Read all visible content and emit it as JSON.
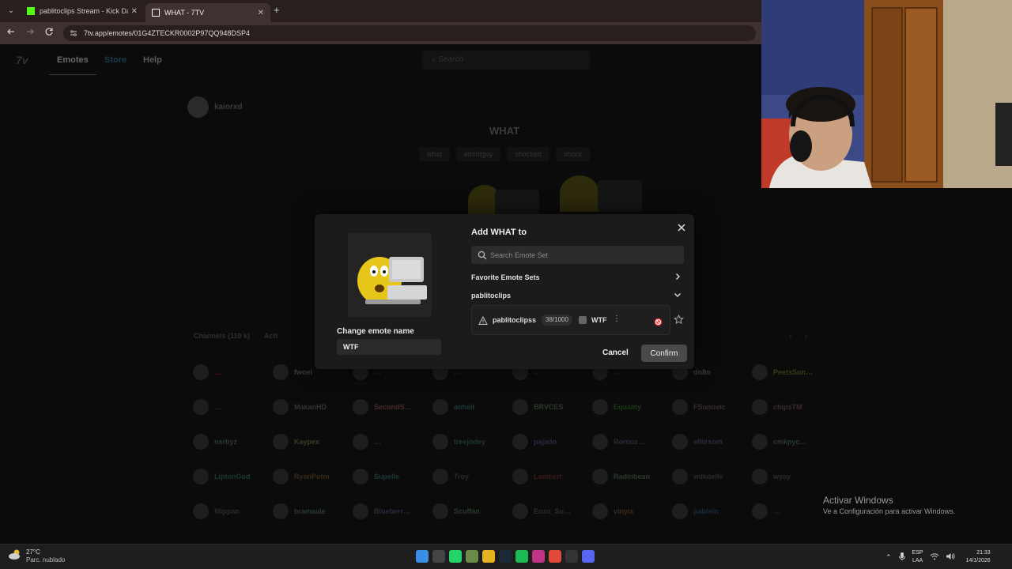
{
  "browser": {
    "tabs": [
      {
        "title": "pablitoclips Stream - Kick Dashb",
        "favicon_color": "#53fc18"
      },
      {
        "title": "WHAT - 7TV",
        "favicon_color": "#ffffff"
      }
    ],
    "new_tab_glyph": "+",
    "tab_menu_glyph": "⌄",
    "close_glyph": "✕",
    "url": "7tv.app/emotes/01G4ZTECKR0002P97QQ948DSP4"
  },
  "site": {
    "logo": "7v",
    "nav": {
      "emotes": "Emotes",
      "store": "Store",
      "help": "Help"
    },
    "search_placeholder": "Search"
  },
  "emote_page": {
    "uploader": "kaiorxd",
    "title": "WHAT",
    "tags": [
      "what",
      "emotiguy",
      "shocked",
      "shock"
    ],
    "channel_tabs": [
      "Channels (110 k)",
      "Acti"
    ]
  },
  "users": [
    {
      "name": "…",
      "color": "#5a1a1a"
    },
    {
      "name": "fwoel",
      "color": "#3a3a3a"
    },
    {
      "name": "…",
      "color": "#2a2a2a"
    },
    {
      "name": "…",
      "color": "#2a2a2a"
    },
    {
      "name": "…",
      "color": "#2a2a2a"
    },
    {
      "name": "…",
      "color": "#2a2a2a"
    },
    {
      "name": "dn8n",
      "color": "#3a3a3a"
    },
    {
      "name": "PeetsSun…",
      "color": "#3a3a18"
    },
    {
      "name": "…",
      "color": "#4a1a3a"
    },
    {
      "name": "MakanHD",
      "color": "#333333"
    },
    {
      "name": "SecondS…",
      "color": "#4a2a2a"
    },
    {
      "name": "aoheil",
      "color": "#1a3a3a"
    },
    {
      "name": "BRVCES",
      "color": "#2a3a2a"
    },
    {
      "name": "Equality",
      "color": "#1a3a1a"
    },
    {
      "name": "FSunovic",
      "color": "#3a2a2a"
    },
    {
      "name": "chipsTM",
      "color": "#3a2a2a"
    },
    {
      "name": "nsrbyz",
      "color": "#2a3a2a"
    },
    {
      "name": "Kaypex",
      "color": "#3a3a2a"
    },
    {
      "name": "…",
      "color": "#3a2a2a"
    },
    {
      "name": "treejodey",
      "color": "#1a3a2a"
    },
    {
      "name": "pajado",
      "color": "#2a2a3a"
    },
    {
      "name": "Rorouz…",
      "color": "#2a2a3a"
    },
    {
      "name": "elliirsom",
      "color": "#2a2a3a"
    },
    {
      "name": "cmkpyc…",
      "color": "#2a3a2a"
    },
    {
      "name": "LiptonGod",
      "color": "#1a3a2a"
    },
    {
      "name": "RyanPotm",
      "color": "#3a2a1a"
    },
    {
      "name": "Supelle",
      "color": "#1a3a3a"
    },
    {
      "name": "Troy",
      "color": "#2a2a2a"
    },
    {
      "name": "Lambert",
      "color": "#3a1a1a"
    },
    {
      "name": "Radiobean",
      "color": "#2a3a2a"
    },
    {
      "name": "wilkdelle",
      "color": "#2a2a2a"
    },
    {
      "name": "wyay",
      "color": "#2a2a2a"
    },
    {
      "name": "filippan",
      "color": "#2a2a2a"
    },
    {
      "name": "bramaale",
      "color": "#2a3a2a"
    },
    {
      "name": "Blueberr…",
      "color": "#2a2a3a"
    },
    {
      "name": "Scuffan",
      "color": "#2a3a2a"
    },
    {
      "name": "Enzo_Su…",
      "color": "#2a2a2a"
    },
    {
      "name": "vinyix",
      "color": "#3a2a1a"
    },
    {
      "name": "pablein",
      "color": "#1a2a3a"
    },
    {
      "name": "…",
      "color": "#1a2a3a"
    }
  ],
  "modal": {
    "title": "Add WHAT to",
    "search_placeholder": "Search Emote Set",
    "favorite_sets": "Favorite Emote Sets",
    "owner": "pablitoclips",
    "set": {
      "name": "pablitoclipss",
      "capacity": "38/1000",
      "alias": "WTF"
    },
    "rename_label": "Change emote name",
    "rename_value": "WTF",
    "cancel": "Cancel",
    "confirm": "Confirm"
  },
  "watermark": {
    "title": "Activar Windows",
    "subtitle": "Ve a Configuración para activar Windows."
  },
  "taskbar": {
    "temperature": "27°C",
    "condition": "Parc. nublado",
    "lang_top": "ESP",
    "lang_bottom": "LAA",
    "time": "21:33",
    "date": "14/1/2026",
    "apps": [
      {
        "name": "start",
        "color": "#3a8ee6"
      },
      {
        "name": "search",
        "color": "#444444"
      },
      {
        "name": "whatsapp",
        "color": "#25d366"
      },
      {
        "name": "app",
        "color": "#6a8a4a"
      },
      {
        "name": "files",
        "color": "#e6b422"
      },
      {
        "name": "steam",
        "color": "#1b2838"
      },
      {
        "name": "spotify",
        "color": "#1db954"
      },
      {
        "name": "instagram",
        "color": "#c13584"
      },
      {
        "name": "chrome",
        "color": "#e04a3a"
      },
      {
        "name": "obs",
        "color": "#333333"
      },
      {
        "name": "discord",
        "color": "#5865f2"
      }
    ]
  }
}
